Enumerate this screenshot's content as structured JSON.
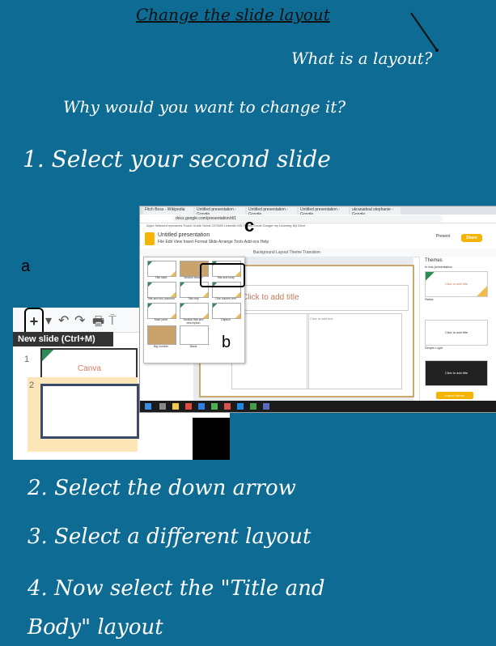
{
  "heading": "Change the slide layout",
  "question1": "What is a layout?",
  "question2": "Why would you want to change it?",
  "step1": "1. Select your second slide",
  "step2": "2. Select the down arrow",
  "step3": "3. Select a different layout",
  "step4_line1": "4. Now select the \"Title and",
  "step4_line2": "Body\" layout",
  "labels": {
    "a": "a",
    "b": "b",
    "c": "c"
  },
  "zoom": {
    "tooltip": "New slide (Ctrl+M)",
    "plus": "+",
    "slide_numbers": [
      "1",
      "2"
    ],
    "thumb_text": "Canva"
  },
  "shot": {
    "tabs": [
      "Fitch Boss - Wikipedia",
      "Untitled presentation - Google",
      "Untitled presentation - Google",
      "Untitled presentation - Google",
      "ukranadeal stephanie - Google"
    ],
    "url": "docs.google.com/presentation/d/1",
    "bookmarks": "Apps  Selected resources  Touch Guide  Serial  CEOMS  LinkedIn  MS Teams  Email  Google  my Learning  My Drive",
    "doc_title": "Untitled presentation",
    "menu": "File  Edit  View  Insert  Format  Slide  Arrange  Tools  Add-ons  Help",
    "toolbar": "Background  Layout  Theme  Transition",
    "present": "Present",
    "share": "Share",
    "title_placeholder": "Click to add title",
    "body_placeholder": "Click to add text",
    "layouts": [
      "Title slide",
      "Section header",
      "Title and body",
      "Title and two columns",
      "Title only",
      "One column text",
      "Main point",
      "Section title and description",
      "Caption",
      "Big number",
      "Blank"
    ],
    "themes_title": "Themes",
    "theme_labels": [
      "In this presentation",
      "Swiss",
      "Simple Light"
    ],
    "theme_texts": [
      "Click to add title",
      "Click to add title",
      "Click to add title"
    ],
    "import_theme": "Import theme"
  }
}
